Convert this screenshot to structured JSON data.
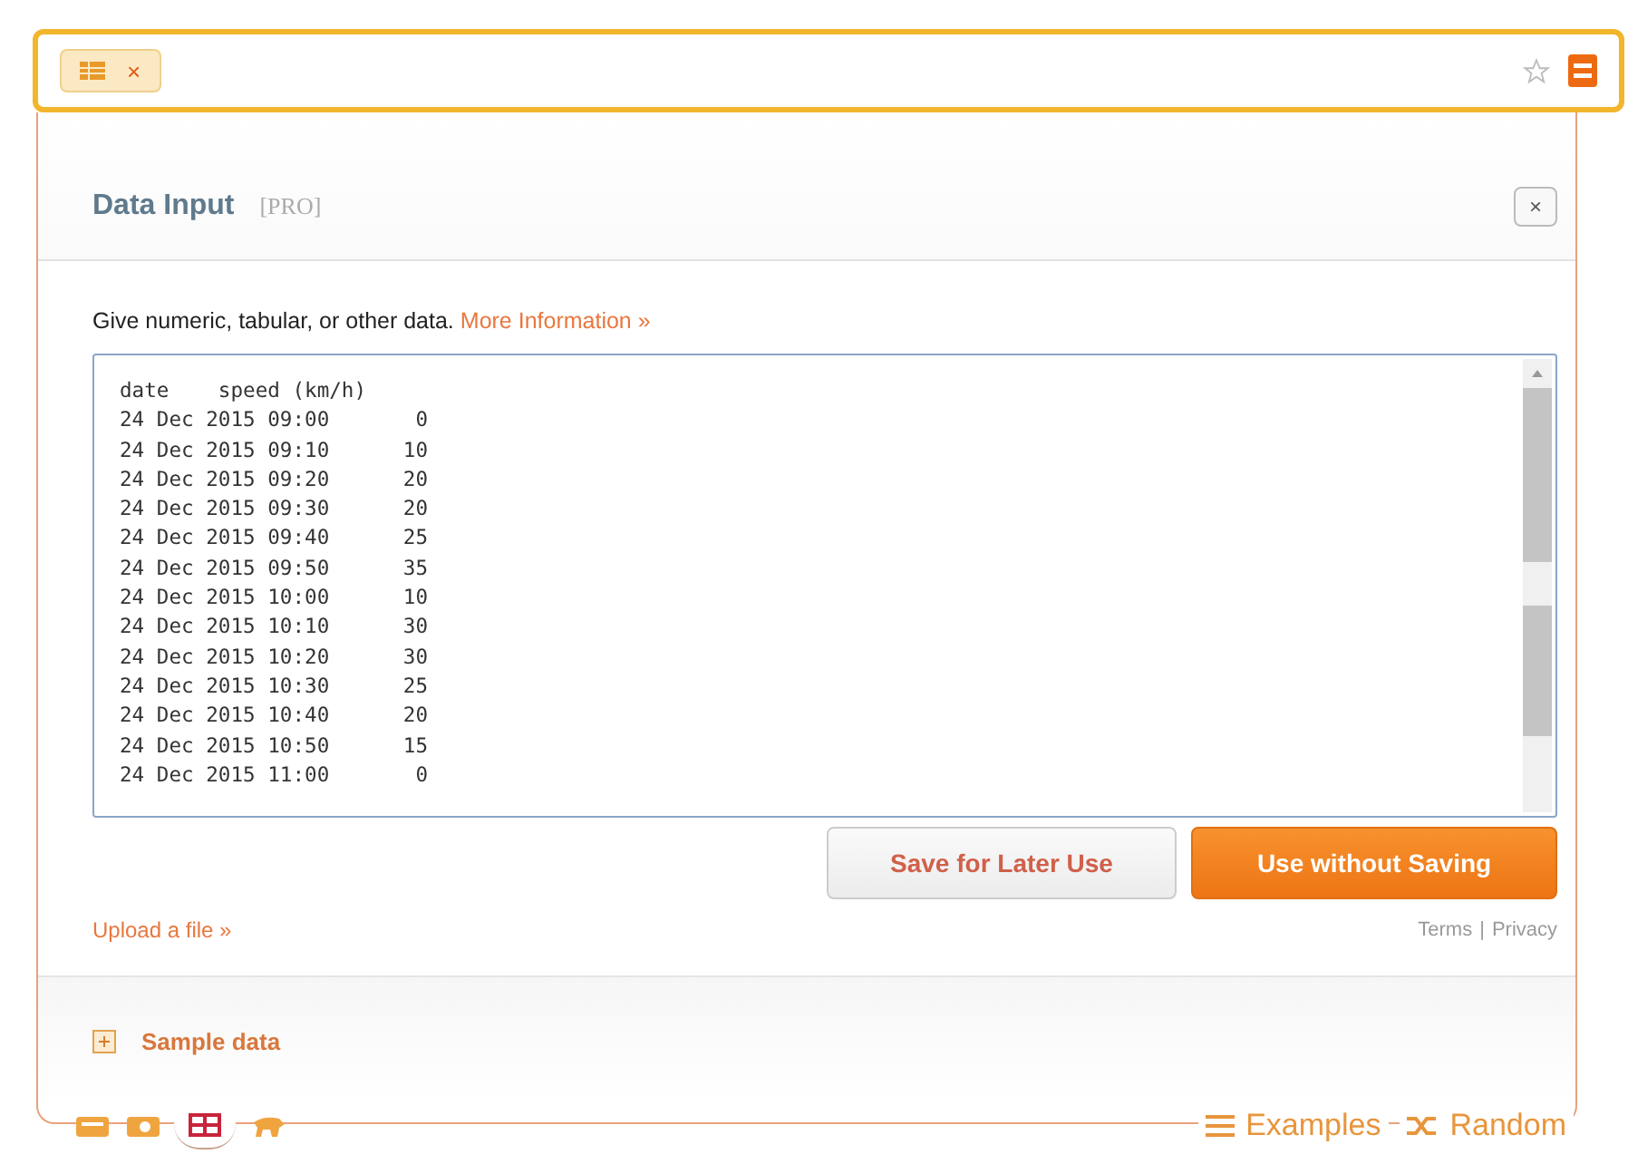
{
  "query_bar": {
    "tokens": [
      {
        "kind": "table",
        "remove": "×"
      }
    ]
  },
  "panel": {
    "title": "Data Input",
    "badge": "[PRO]",
    "close": "×",
    "prompt": "Give numeric, tabular, or other data.",
    "more_link": "More Information »",
    "data_lines": [
      "date    speed (km/h)",
      "24 Dec 2015 09:00       0",
      "24 Dec 2015 09:10      10",
      "24 Dec 2015 09:20      20",
      "24 Dec 2015 09:30      20",
      "24 Dec 2015 09:40      25",
      "24 Dec 2015 09:50      35",
      "24 Dec 2015 10:00      10",
      "24 Dec 2015 10:10      30",
      "24 Dec 2015 10:20      30",
      "24 Dec 2015 10:30      25",
      "24 Dec 2015 10:40      20",
      "24 Dec 2015 10:50      15",
      "24 Dec 2015 11:00       0"
    ],
    "buttons": [
      {
        "label": "Save for Later Use",
        "kind": "secondary"
      },
      {
        "label": "Use without Saving",
        "kind": "primary"
      }
    ],
    "upload_link": "Upload a file »",
    "terms": "Terms",
    "separator": "|",
    "privacy": "Privacy",
    "sample": {
      "label": "Sample data",
      "expanded": false
    }
  },
  "modes": [
    {
      "kind": "keyboard",
      "selected": false
    },
    {
      "kind": "camera",
      "selected": false
    },
    {
      "kind": "table",
      "selected": true
    },
    {
      "kind": "animal",
      "selected": false
    }
  ],
  "links": [
    {
      "kind": "examples",
      "label": "Examples"
    },
    {
      "kind": "random",
      "label": "Random"
    }
  ]
}
